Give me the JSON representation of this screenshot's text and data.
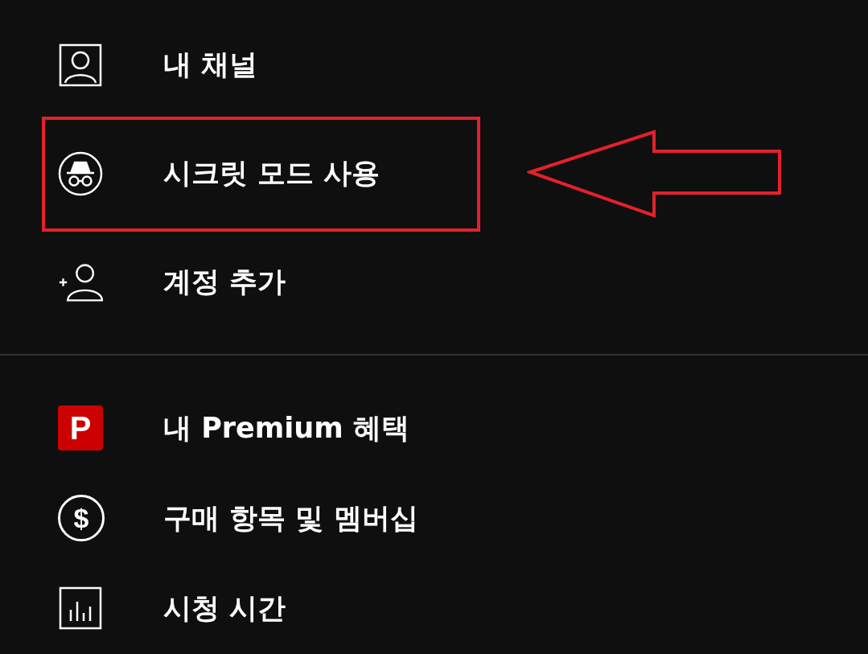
{
  "sections": [
    {
      "items": [
        {
          "kind": "account",
          "label": "내 채널",
          "highlighted": false
        },
        {
          "kind": "incognito",
          "label": "시크릿 모드 사용",
          "highlighted": true
        },
        {
          "kind": "add",
          "label": "계정 추가",
          "highlighted": false
        }
      ]
    },
    {
      "items": [
        {
          "kind": "premium",
          "glyph": "P",
          "label": "내 Premium 혜택",
          "highlighted": false
        },
        {
          "kind": "dollar",
          "glyph": "$",
          "label": "구매 항목 및 멤버십",
          "highlighted": false
        },
        {
          "kind": "chart",
          "label": "시청 시간",
          "highlighted": false
        }
      ]
    }
  ]
}
